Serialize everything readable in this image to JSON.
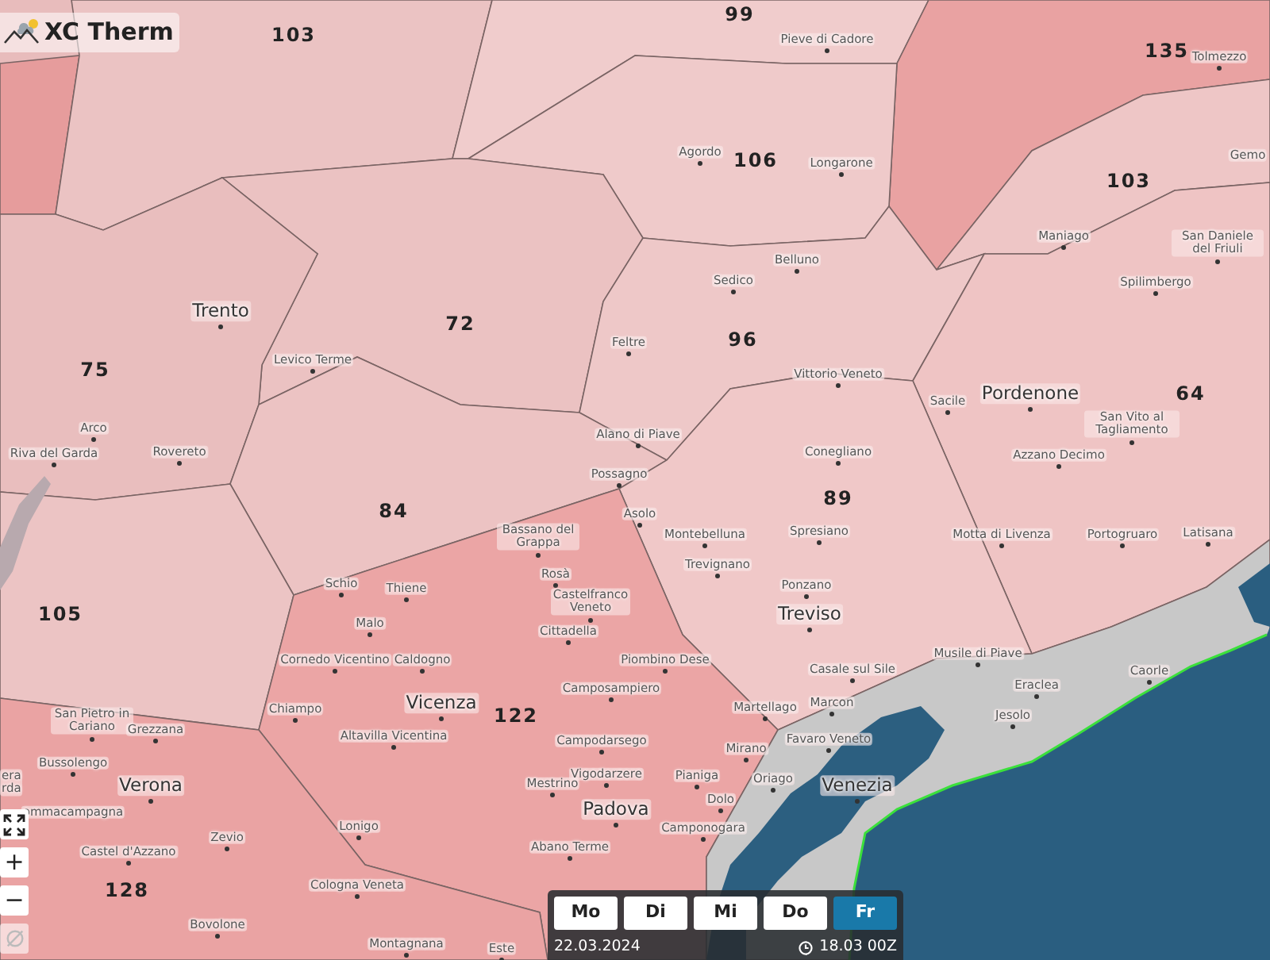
{
  "app": {
    "title": "XC Therm"
  },
  "zones": [
    {
      "color": "#e69c9c"
    },
    {
      "label": "103",
      "color": "#ebc3c3"
    },
    {
      "label": "99",
      "color": "#f0cccc"
    },
    {
      "label": "135",
      "color": "#e9a2a2"
    },
    {
      "label": "106",
      "color": "#efcaca"
    },
    {
      "label": "103",
      "color": "#eec6c6"
    },
    {
      "label": "72",
      "color": "#ebc2c2"
    },
    {
      "label": "96",
      "color": "#eec8c8"
    },
    {
      "label": "75",
      "color": "#e9bebe"
    },
    {
      "label": "64",
      "color": "#efc4c4"
    },
    {
      "label": "84",
      "color": "#ecc3c3"
    },
    {
      "label": "89",
      "color": "#f0c8c8"
    },
    {
      "label": "105",
      "color": "#ecc4c4"
    },
    {
      "label": "122",
      "color": "#eba5a5"
    },
    {
      "label": "128",
      "color": "#eaa3a3"
    }
  ],
  "places": [
    {
      "name": "Pieve di Cadore",
      "kind": "town"
    },
    {
      "name": "Tolmezzo",
      "kind": "town"
    },
    {
      "name": "Agordo",
      "kind": "town"
    },
    {
      "name": "Longarone",
      "kind": "town"
    },
    {
      "name": "Gemo",
      "kind": "cut"
    },
    {
      "name": "Maniago",
      "kind": "town"
    },
    {
      "name": "San Daniele del Friuli",
      "kind": "town"
    },
    {
      "name": "Belluno",
      "kind": "town"
    },
    {
      "name": "Sedico",
      "kind": "town"
    },
    {
      "name": "Spilimbergo",
      "kind": "town"
    },
    {
      "name": "Trento",
      "kind": "city"
    },
    {
      "name": "Feltre",
      "kind": "town"
    },
    {
      "name": "Levico Terme",
      "kind": "town"
    },
    {
      "name": "Vittorio Veneto",
      "kind": "town"
    },
    {
      "name": "Sacile",
      "kind": "town"
    },
    {
      "name": "Pordenone",
      "kind": "city"
    },
    {
      "name": "Arco",
      "kind": "town"
    },
    {
      "name": "Alano di Piave",
      "kind": "town"
    },
    {
      "name": "San Vito al Tagliamento",
      "kind": "town"
    },
    {
      "name": "Riva del Garda",
      "kind": "town"
    },
    {
      "name": "Rovereto",
      "kind": "town"
    },
    {
      "name": "Conegliano",
      "kind": "town"
    },
    {
      "name": "Azzano Decimo",
      "kind": "town"
    },
    {
      "name": "Possagno",
      "kind": "town"
    },
    {
      "name": "Asolo",
      "kind": "town"
    },
    {
      "name": "Bassano del Grappa",
      "kind": "town"
    },
    {
      "name": "Montebelluna",
      "kind": "town"
    },
    {
      "name": "Spresiano",
      "kind": "town"
    },
    {
      "name": "Motta di Livenza",
      "kind": "town"
    },
    {
      "name": "Portogruaro",
      "kind": "town"
    },
    {
      "name": "Latisana",
      "kind": "town"
    },
    {
      "name": "Rosà",
      "kind": "town"
    },
    {
      "name": "Trevignano",
      "kind": "town"
    },
    {
      "name": "Schio",
      "kind": "town"
    },
    {
      "name": "Thiene",
      "kind": "town"
    },
    {
      "name": "Ponzano",
      "kind": "town"
    },
    {
      "name": "Castelfranco Veneto",
      "kind": "town"
    },
    {
      "name": "Malo",
      "kind": "town"
    },
    {
      "name": "Cittadella",
      "kind": "town"
    },
    {
      "name": "Treviso",
      "kind": "city"
    },
    {
      "name": "Cornedo Vicentino",
      "kind": "town"
    },
    {
      "name": "Caldogno",
      "kind": "town"
    },
    {
      "name": "Piombino Dese",
      "kind": "town"
    },
    {
      "name": "Casale sul Sile",
      "kind": "town"
    },
    {
      "name": "Musile di Piave",
      "kind": "town"
    },
    {
      "name": "Caorle",
      "kind": "town"
    },
    {
      "name": "Camposampiero",
      "kind": "town"
    },
    {
      "name": "Eraclea",
      "kind": "town"
    },
    {
      "name": "San Pietro in Cariano",
      "kind": "town"
    },
    {
      "name": "Grezzana",
      "kind": "town"
    },
    {
      "name": "Chiampo",
      "kind": "town"
    },
    {
      "name": "Vicenza",
      "kind": "city"
    },
    {
      "name": "Martellago",
      "kind": "town"
    },
    {
      "name": "Marcon",
      "kind": "town"
    },
    {
      "name": "Jesolo",
      "kind": "town"
    },
    {
      "name": "Altavilla Vicentina",
      "kind": "town"
    },
    {
      "name": "Campodarsego",
      "kind": "town"
    },
    {
      "name": "Mirano",
      "kind": "town"
    },
    {
      "name": "Favaro Veneto",
      "kind": "town"
    },
    {
      "name": "era rda",
      "kind": "cut"
    },
    {
      "name": "Bussolengo",
      "kind": "town"
    },
    {
      "name": "Verona",
      "kind": "city"
    },
    {
      "name": "Mestrino",
      "kind": "town"
    },
    {
      "name": "Vigodarzere",
      "kind": "town"
    },
    {
      "name": "Pianiga",
      "kind": "town"
    },
    {
      "name": "Oriago",
      "kind": "town"
    },
    {
      "name": "Venezia",
      "kind": "city"
    },
    {
      "name": "Padova",
      "kind": "city"
    },
    {
      "name": "Dolo",
      "kind": "town"
    },
    {
      "name": "ommacampagna",
      "kind": "cut"
    },
    {
      "name": "Zevio",
      "kind": "town"
    },
    {
      "name": "Lonigo",
      "kind": "town"
    },
    {
      "name": "Camponogara",
      "kind": "town"
    },
    {
      "name": "Castel d'Azzano",
      "kind": "town"
    },
    {
      "name": "Abano Terme",
      "kind": "town"
    },
    {
      "name": "Cologna Veneta",
      "kind": "town"
    },
    {
      "name": "Bovolone",
      "kind": "town"
    },
    {
      "name": "Montagnana",
      "kind": "town"
    },
    {
      "name": "Este",
      "kind": "town"
    }
  ],
  "map_controls": [
    {
      "kind": "fullscreen",
      "disabled": false
    },
    {
      "kind": "zoom_in",
      "label": "+",
      "disabled": false
    },
    {
      "kind": "zoom_out",
      "label": "−",
      "disabled": false
    },
    {
      "kind": "locate",
      "disabled": true
    }
  ],
  "days": [
    {
      "label": "Mo",
      "selected": false
    },
    {
      "label": "Di",
      "selected": false
    },
    {
      "label": "Mi",
      "selected": false
    },
    {
      "label": "Do",
      "selected": false
    },
    {
      "label": "Fr",
      "selected": true
    }
  ],
  "date": "22.03.2024",
  "run_time": "18.03 00Z"
}
